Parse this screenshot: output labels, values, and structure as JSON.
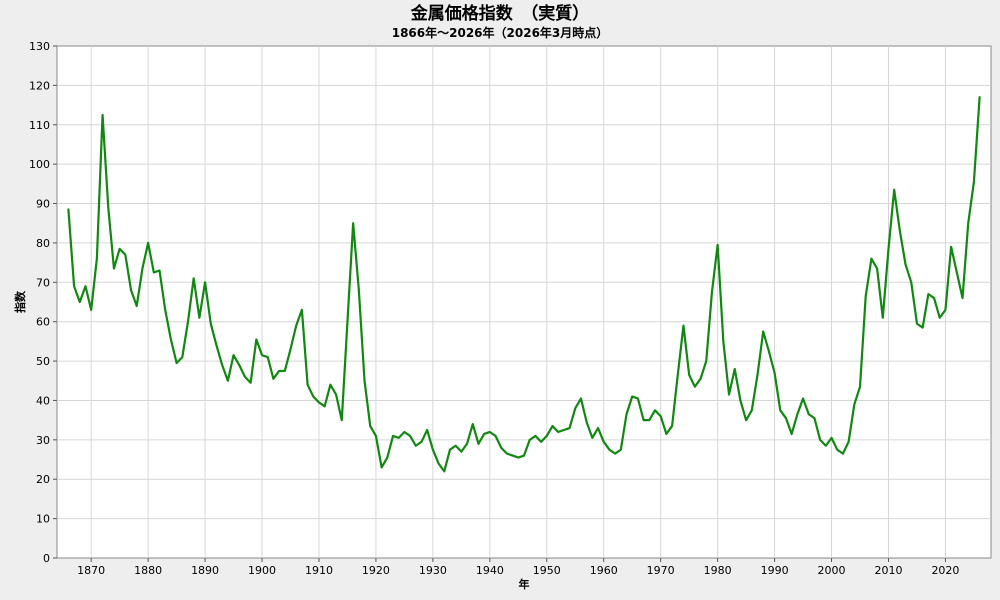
{
  "chart_data": {
    "type": "line",
    "title": "金属価格指数　（実質）",
    "subtitle": "1866年～2026年（2026年3月時点）",
    "xlabel": "年",
    "ylabel": "指数",
    "xlim": [
      1864,
      2028
    ],
    "ylim": [
      0,
      130
    ],
    "x_ticks": [
      1870,
      1880,
      1890,
      1900,
      1910,
      1920,
      1930,
      1940,
      1950,
      1960,
      1970,
      1980,
      1990,
      2000,
      2010,
      2020
    ],
    "y_ticks": [
      0,
      10,
      20,
      30,
      40,
      50,
      60,
      70,
      80,
      90,
      100,
      110,
      120,
      130
    ],
    "grid": true,
    "series_color": "#118811",
    "series": [
      {
        "x": [
          1866,
          1867,
          1868,
          1869,
          1870,
          1871,
          1872,
          1873,
          1874,
          1875,
          1876,
          1877,
          1878,
          1879,
          1880,
          1881,
          1882,
          1883,
          1884,
          1885,
          1886,
          1887,
          1888,
          1889,
          1890,
          1891,
          1892,
          1893,
          1894,
          1895,
          1896,
          1897,
          1898,
          1899,
          1900,
          1901,
          1902,
          1903,
          1904,
          1905,
          1906,
          1907,
          1908,
          1909,
          1910,
          1911,
          1912,
          1913,
          1914,
          1915,
          1916,
          1917,
          1918,
          1919,
          1920,
          1921,
          1922,
          1923,
          1924,
          1925,
          1926,
          1927,
          1928,
          1929,
          1930,
          1931,
          1932,
          1933,
          1934,
          1935,
          1936,
          1937,
          1938,
          1939,
          1940,
          1941,
          1942,
          1943,
          1944,
          1945,
          1946,
          1947,
          1948,
          1949,
          1950,
          1951,
          1952,
          1953,
          1954,
          1955,
          1956,
          1957,
          1958,
          1959,
          1960,
          1961,
          1962,
          1963,
          1964,
          1965,
          1966,
          1967,
          1968,
          1969,
          1970,
          1971,
          1972,
          1973,
          1974,
          1975,
          1976,
          1977,
          1978,
          1979,
          1980,
          1981,
          1982,
          1983,
          1984,
          1985,
          1986,
          1987,
          1988,
          1989,
          1990,
          1991,
          1992,
          1993,
          1994,
          1995,
          1996,
          1997,
          1998,
          1999,
          2000,
          2001,
          2002,
          2003,
          2004,
          2005,
          2006,
          2007,
          2008,
          2009,
          2010,
          2011,
          2012,
          2013,
          2014,
          2015,
          2016,
          2017,
          2018,
          2019,
          2020,
          2021,
          2022,
          2023,
          2024,
          2025,
          2026
        ],
        "y": [
          88.5,
          69,
          65,
          69,
          63,
          76,
          112.5,
          89,
          73.5,
          78.5,
          77,
          68,
          64,
          73.5,
          80,
          72.5,
          73,
          63,
          55.5,
          49.5,
          51,
          60,
          71,
          61,
          70,
          59.5,
          54,
          49,
          45,
          51.5,
          49,
          46,
          44.5,
          55.5,
          51.5,
          51,
          45.5,
          47.5,
          47.5,
          53,
          59,
          63,
          44,
          41,
          39.5,
          38.5,
          44,
          41.5,
          35,
          60,
          85,
          68,
          45,
          33.5,
          31,
          23,
          25.5,
          31,
          30.5,
          32,
          31,
          28.5,
          29.5,
          32.5,
          27.5,
          24,
          22,
          27.5,
          28.5,
          27,
          29,
          34,
          29,
          31.5,
          32,
          31,
          28,
          26.5,
          26,
          25.5,
          26,
          30,
          31,
          29.5,
          31,
          33.5,
          32,
          32.5,
          33,
          38,
          40.5,
          34.5,
          30.5,
          33,
          29.5,
          27.5,
          26.5,
          27.5,
          36.5,
          41,
          40.5,
          35,
          35,
          37.5,
          36,
          31.5,
          33.5,
          46.5,
          59,
          46.5,
          43.5,
          45.5,
          50,
          67.5,
          79.5,
          55,
          41.5,
          48,
          40,
          35,
          37.5,
          46.5,
          57.5,
          52.5,
          47,
          37.5,
          35.5,
          31.5,
          36.5,
          40.5,
          36.5,
          35.5,
          30,
          28.5,
          30.5,
          27.5,
          26.5,
          29.5,
          39,
          43.5,
          66.5,
          76,
          73.5,
          61,
          78.5,
          93.5,
          83,
          74.5,
          70,
          59.5,
          58.5,
          67,
          66,
          61,
          63,
          79,
          72.5,
          66,
          85,
          95.5,
          117
        ]
      }
    ]
  }
}
